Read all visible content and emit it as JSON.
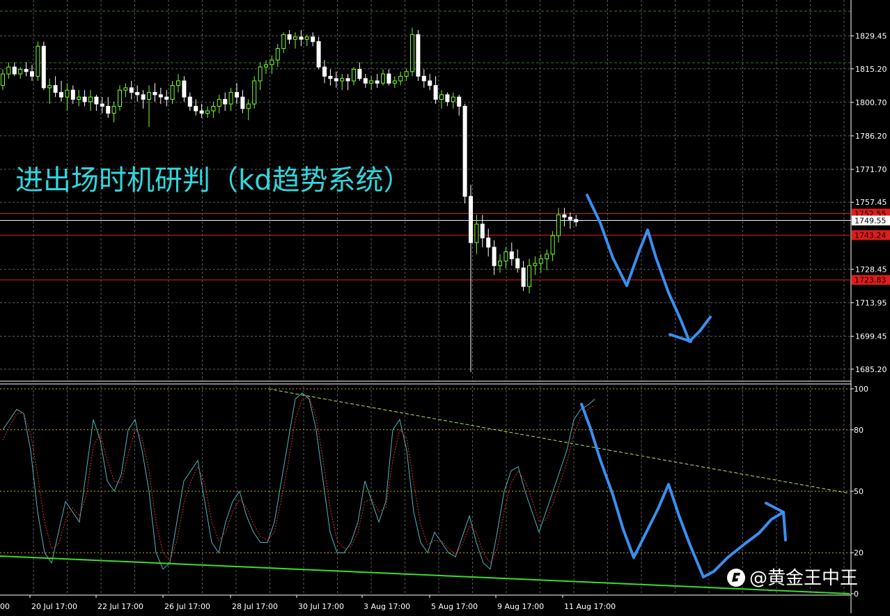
{
  "colors": {
    "background": "#000000",
    "grid": "#5c5c5c",
    "bull": "#78ff2a",
    "bear": "#ffffff",
    "level": "#e21b1b",
    "price_box": "#e21b1b",
    "stoch_k": "#4fb7c0",
    "stoch_d": "#e03030",
    "trendline": "#3ddc2a",
    "upper_trend": "#b7e85a",
    "arrow": "#3a8ff0",
    "title": "#31d6dc"
  },
  "overlay": {
    "title": "进出场时机研判（kd趋势系统）",
    "watermark": "@黄金王中王",
    "logo_icon": "toutiao-logo-icon"
  },
  "chart_data": [
    {
      "type": "candlestick",
      "title": "",
      "y_ticks": [
        "1829.45",
        "1815.20",
        "1800.70",
        "1786.20",
        "1771.70",
        "1757.45",
        "1728.45",
        "1713.95",
        "1699.45",
        "1685.20"
      ],
      "ylim": [
        1680,
        1845
      ],
      "x_ticks": [
        "20 Jul 17:00",
        "22 Jul 17:00",
        "26 Jul 17:00",
        "28 Jul 17:00",
        "30 Jul 17:00",
        "3 Aug 17:00",
        "5 Aug 17:00",
        "9 Aug 17:00",
        "11 Aug 17:00"
      ],
      "x_ticks_first_partial": "00",
      "levels": [
        {
          "value": 1752.55,
          "label": "1752.55",
          "color": "#e21b1b",
          "boxed": true
        },
        {
          "value": 1749.55,
          "label": "1749.55",
          "color": "#ffffff",
          "boxed": true
        },
        {
          "value": 1743.24,
          "label": "1743.24",
          "color": "#e21b1b",
          "boxed": true
        },
        {
          "value": 1723.83,
          "label": "1723.83",
          "color": "#e21b1b",
          "boxed": true
        }
      ],
      "candles_ohlc": [
        [
          1808,
          1815,
          1806,
          1813
        ],
        [
          1813,
          1818,
          1811,
          1816
        ],
        [
          1816,
          1818,
          1812,
          1813
        ],
        [
          1813,
          1816,
          1811,
          1815
        ],
        [
          1815,
          1818,
          1812,
          1814
        ],
        [
          1814,
          1817,
          1810,
          1812
        ],
        [
          1812,
          1827,
          1810,
          1825
        ],
        [
          1825,
          1827,
          1806,
          1807
        ],
        [
          1807,
          1811,
          1800,
          1808
        ],
        [
          1808,
          1812,
          1803,
          1805
        ],
        [
          1805,
          1810,
          1801,
          1803
        ],
        [
          1803,
          1809,
          1797,
          1806
        ],
        [
          1806,
          1808,
          1800,
          1802
        ],
        [
          1802,
          1806,
          1799,
          1803
        ],
        [
          1803,
          1806,
          1799,
          1801
        ],
        [
          1801,
          1806,
          1797,
          1803
        ],
        [
          1803,
          1804,
          1797,
          1800
        ],
        [
          1800,
          1803,
          1796,
          1799
        ],
        [
          1799,
          1803,
          1794,
          1796
        ],
        [
          1796,
          1801,
          1792,
          1799
        ],
        [
          1799,
          1808,
          1797,
          1806
        ],
        [
          1806,
          1809,
          1803,
          1807
        ],
        [
          1807,
          1810,
          1802,
          1805
        ],
        [
          1805,
          1808,
          1801,
          1804
        ],
        [
          1804,
          1806,
          1798,
          1802
        ],
        [
          1802,
          1808,
          1790,
          1805
        ],
        [
          1805,
          1809,
          1801,
          1804
        ],
        [
          1804,
          1807,
          1800,
          1803
        ],
        [
          1803,
          1806,
          1799,
          1802
        ],
        [
          1802,
          1810,
          1800,
          1808
        ],
        [
          1808,
          1813,
          1805,
          1810
        ],
        [
          1810,
          1812,
          1801,
          1803
        ],
        [
          1803,
          1805,
          1797,
          1799
        ],
        [
          1799,
          1802,
          1795,
          1797
        ],
        [
          1797,
          1800,
          1794,
          1796
        ],
        [
          1796,
          1799,
          1794,
          1797
        ],
        [
          1797,
          1801,
          1794,
          1799
        ],
        [
          1799,
          1804,
          1796,
          1802
        ],
        [
          1802,
          1805,
          1797,
          1800
        ],
        [
          1800,
          1807,
          1797,
          1805
        ],
        [
          1805,
          1809,
          1800,
          1803
        ],
        [
          1803,
          1806,
          1796,
          1798
        ],
        [
          1798,
          1802,
          1793,
          1800
        ],
        [
          1800,
          1812,
          1798,
          1810
        ],
        [
          1810,
          1818,
          1806,
          1816
        ],
        [
          1816,
          1819,
          1813,
          1817
        ],
        [
          1817,
          1821,
          1813,
          1819
        ],
        [
          1819,
          1826,
          1816,
          1824
        ],
        [
          1824,
          1831,
          1822,
          1830
        ],
        [
          1830,
          1832,
          1826,
          1828
        ],
        [
          1828,
          1831,
          1824,
          1829
        ],
        [
          1829,
          1832,
          1825,
          1828
        ],
        [
          1828,
          1830,
          1825,
          1829
        ],
        [
          1829,
          1831,
          1825,
          1827
        ],
        [
          1827,
          1829,
          1815,
          1816
        ],
        [
          1816,
          1819,
          1809,
          1812
        ],
        [
          1812,
          1815,
          1808,
          1811
        ],
        [
          1811,
          1814,
          1807,
          1810
        ],
        [
          1810,
          1813,
          1806,
          1811
        ],
        [
          1811,
          1813,
          1806,
          1810
        ],
        [
          1810,
          1816,
          1808,
          1815
        ],
        [
          1815,
          1818,
          1810,
          1811
        ],
        [
          1811,
          1813,
          1807,
          1809
        ],
        [
          1809,
          1812,
          1806,
          1810
        ],
        [
          1810,
          1813,
          1807,
          1809
        ],
        [
          1809,
          1815,
          1808,
          1813
        ],
        [
          1813,
          1815,
          1808,
          1809
        ],
        [
          1809,
          1812,
          1807,
          1810
        ],
        [
          1810,
          1814,
          1808,
          1812
        ],
        [
          1812,
          1815,
          1810,
          1814
        ],
        [
          1814,
          1833,
          1812,
          1830
        ],
        [
          1830,
          1832,
          1810,
          1812
        ],
        [
          1812,
          1815,
          1807,
          1810
        ],
        [
          1810,
          1813,
          1806,
          1808
        ],
        [
          1808,
          1812,
          1800,
          1802
        ],
        [
          1802,
          1806,
          1798,
          1804
        ],
        [
          1804,
          1805,
          1799,
          1801
        ],
        [
          1801,
          1805,
          1798,
          1803
        ],
        [
          1803,
          1804,
          1795,
          1799
        ],
        [
          1799,
          1800,
          1757,
          1760
        ],
        [
          1760,
          1765,
          1684,
          1740
        ],
        [
          1740,
          1752,
          1735,
          1748
        ],
        [
          1748,
          1752,
          1738,
          1742
        ],
        [
          1742,
          1746,
          1734,
          1738
        ],
        [
          1738,
          1741,
          1726,
          1730
        ],
        [
          1730,
          1735,
          1727,
          1732
        ],
        [
          1732,
          1738,
          1729,
          1736
        ],
        [
          1736,
          1740,
          1730,
          1733
        ],
        [
          1733,
          1737,
          1727,
          1729
        ],
        [
          1729,
          1732,
          1719,
          1721
        ],
        [
          1721,
          1733,
          1718,
          1730
        ],
        [
          1730,
          1734,
          1726,
          1731
        ],
        [
          1731,
          1735,
          1727,
          1733
        ],
        [
          1733,
          1737,
          1728,
          1735
        ],
        [
          1735,
          1745,
          1732,
          1743
        ],
        [
          1743,
          1755,
          1740,
          1752
        ],
        [
          1752,
          1755,
          1747,
          1751
        ],
        [
          1751,
          1753,
          1746,
          1750
        ],
        [
          1750,
          1752,
          1747,
          1749
        ]
      ],
      "arrow_path_price": [
        [
          843,
          280
        ],
        [
          862,
          320
        ],
        [
          880,
          370
        ],
        [
          900,
          410
        ],
        [
          918,
          360
        ],
        [
          930,
          330
        ],
        [
          942,
          370
        ],
        [
          960,
          420
        ],
        [
          978,
          460
        ],
        [
          990,
          490
        ],
        [
          1005,
          475
        ],
        [
          1020,
          455
        ]
      ],
      "arrow_head_price": [
        [
          962,
          480
        ],
        [
          992,
          490
        ]
      ]
    },
    {
      "type": "line",
      "title": "",
      "y_ticks": [
        "100",
        "80",
        "50",
        "20",
        "0"
      ],
      "ylim": [
        0,
        100
      ],
      "dotted_levels": [
        100,
        80,
        50,
        20
      ],
      "series": [
        {
          "values": [
            80,
            85,
            90,
            88,
            70,
            40,
            20,
            15,
            30,
            45,
            40,
            35,
            60,
            85,
            75,
            55,
            50,
            58,
            80,
            85,
            70,
            50,
            20,
            12,
            15,
            35,
            55,
            60,
            65,
            45,
            25,
            20,
            35,
            45,
            50,
            38,
            30,
            25,
            25,
            35,
            55,
            75,
            95,
            98,
            95,
            80,
            55,
            30,
            20,
            20,
            25,
            35,
            55,
            45,
            35,
            45,
            80,
            85,
            70,
            40,
            25,
            20,
            30,
            25,
            20,
            18,
            28,
            38,
            25,
            15,
            12,
            30,
            50,
            60,
            62,
            50,
            40,
            30,
            40,
            50,
            60,
            70,
            85,
            90,
            92,
            95
          ]
        },
        {
          "values": [
            75,
            82,
            88,
            88,
            78,
            58,
            35,
            22,
            24,
            36,
            42,
            38,
            48,
            72,
            78,
            65,
            55,
            54,
            68,
            80,
            76,
            60,
            35,
            20,
            16,
            26,
            44,
            55,
            62,
            54,
            35,
            26,
            30,
            40,
            46,
            42,
            34,
            28,
            26,
            30,
            46,
            64,
            85,
            95,
            96,
            86,
            65,
            42,
            26,
            22,
            23,
            30,
            45,
            46,
            40,
            42,
            65,
            80,
            76,
            54,
            34,
            24,
            26,
            26,
            22,
            19,
            24,
            33,
            30,
            20,
            15,
            22,
            40,
            54,
            60,
            55,
            46,
            35,
            36,
            44,
            54,
            64,
            78,
            86,
            90,
            92
          ]
        }
      ],
      "trendlines": [
        {
          "kind": "support",
          "color": "#3ddc2a"
        },
        {
          "kind": "resistance",
          "color": "#b7e85a"
        }
      ],
      "arrow_path_stoch": [
        [
          835,
          580
        ],
        [
          848,
          615
        ],
        [
          862,
          660
        ],
        [
          880,
          710
        ],
        [
          895,
          760
        ],
        [
          910,
          800
        ],
        [
          930,
          760
        ],
        [
          945,
          730
        ],
        [
          960,
          695
        ],
        [
          975,
          740
        ],
        [
          990,
          780
        ],
        [
          1010,
          828
        ],
        [
          1025,
          820
        ],
        [
          1045,
          800
        ],
        [
          1070,
          780
        ],
        [
          1090,
          765
        ],
        [
          1108,
          745
        ],
        [
          1125,
          735
        ],
        [
          1128,
          775
        ]
      ],
      "arrow_head_stoch": [
        [
          1100,
          722
        ],
        [
          1125,
          735
        ]
      ]
    }
  ]
}
